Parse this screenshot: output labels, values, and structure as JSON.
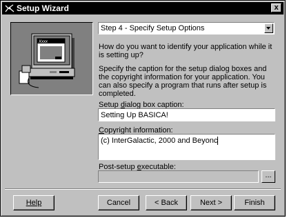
{
  "window": {
    "title": "Setup Wizard",
    "close_glyph": "x"
  },
  "step": {
    "selected": "Step 4 - Specify Setup Options"
  },
  "instructions": {
    "question": "How do you want to identify your application while it is setting up?",
    "detail": "Specify the caption for the setup dialog boxes and the copyright information for your application.  You can also specify a program that runs after setup is completed."
  },
  "fields": {
    "caption_label_prefix": "Setup ",
    "caption_label_accel": "d",
    "caption_label_suffix": "ialog box caption:",
    "caption_value": "Setting Up BASICA!",
    "copyright_label_accel": "C",
    "copyright_label_suffix": "opyright information:",
    "copyright_value": "(c) InterGalactic, 2000 and Beyonc",
    "post_label_prefix": "Post-setup ",
    "post_label_accel": "e",
    "post_label_suffix": "xecutable:",
    "post_value": "",
    "browse_label": "..."
  },
  "illustration": {
    "screen_text": "Xxxx"
  },
  "buttons": {
    "help": "Help",
    "cancel": "Cancel",
    "back": "< Back",
    "next": "Next >",
    "finish": "Finish"
  },
  "colors": {
    "face": "#c0c0c0",
    "titlebar": "#000000",
    "illustration_bg": "#808080"
  }
}
